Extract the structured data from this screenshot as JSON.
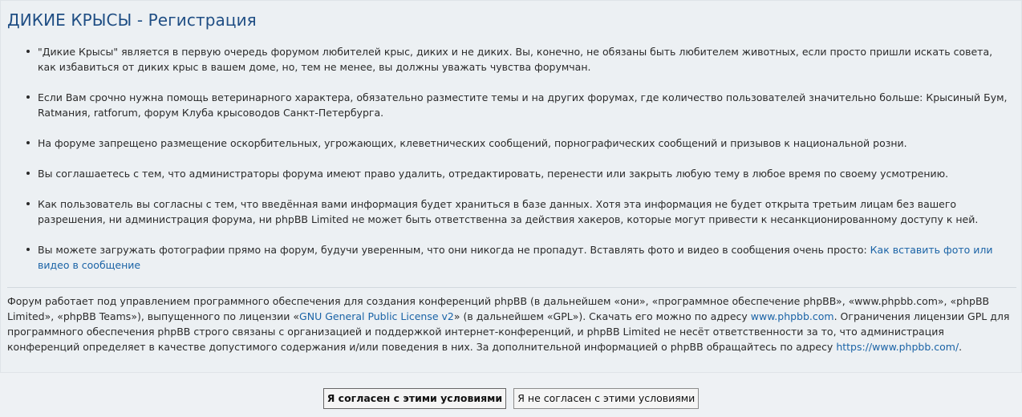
{
  "page": {
    "title": "ДИКИЕ КРЫСЫ - Регистрация"
  },
  "rules": [
    {
      "text": "\"Дикие Крысы\" является в первую очередь форумом любителей крыс, диких и не диких. Вы, конечно, не обязаны быть любителем животных, если просто пришли искать совета, как избавиться от диких крыс в вашем доме, но, тем не менее, вы должны уважать чувства форумчан."
    },
    {
      "text": "Если Вам срочно нужна помощь ветеринарного характера, обязательно разместите темы и на других форумах, где количество пользователей значительно больше: Крысиный Бум, Ratмания, ratforum, форум Клуба крысоводов Санкт-Петербурга."
    },
    {
      "text": "На форуме запрещено размещение оскорбительных, угрожающих, клеветнических сообщений, порнографических сообщений и призывов к национальной розни."
    },
    {
      "text": "Вы соглашаетесь с тем, что администраторы форума имеют право удалить, отредактировать, перенести или закрыть любую тему в любое время по своему усмотрению."
    },
    {
      "text": "Как пользователь вы согласны с тем, что введённая вами информация будет храниться в базе данных. Хотя эта информация не будет открыта третьим лицам без вашего разрешения, ни администрация форума, ни phpBB Limited не может быть ответственна за действия хакеров, которые могут привести к несанкционированному доступу к ней."
    },
    {
      "text": "Вы можете загружать фотографии прямо на форум, будучи уверенным, что они никогда не пропадут. Вставлять фото и видео в сообщения очень просто: ",
      "link": "Как вставить фото или видео в сообщение"
    }
  ],
  "footer": {
    "part1": "Форум работает под управлением программного обеспечения для создания конференций phpBB (в дальнейшем «они», «программное обеспечение phpBB», «www.phpbb.com», «phpBB Limited», «phpBB Teams»), выпущенного по лицензии «",
    "license_link": "GNU General Public License v2",
    "part2": "» (в дальнейшем «GPL»). Скачать его можно по адресу ",
    "download_link": "www.phpbb.com",
    "part3": ". Ограничения лицензии GPL для программного обеспечения phpBB строго связаны с организацией и поддержкой интернет-конференций, и phpBB Limited не несёт ответственности за то, что администрация конференций определяет в качестве допустимого содержания и/или поведения в них. За дополнительной информацией о phpBB обращайтесь по адресу ",
    "info_link": "https://www.phpbb.com/",
    "part4": "."
  },
  "buttons": {
    "agree": "Я согласен с этими условиями",
    "disagree": "Я не согласен с этими условиями"
  }
}
